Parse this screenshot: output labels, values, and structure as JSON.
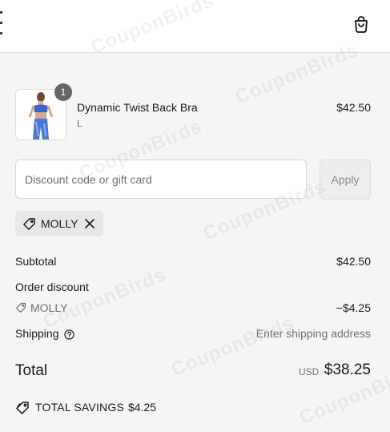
{
  "watermark": "CouponBirds",
  "header": {
    "menu_icon": "menu-icon",
    "cart_icon": "shopping-bag-icon"
  },
  "line_item": {
    "quantity": "1",
    "name": "Dynamic Twist Back Bra",
    "variant": "L",
    "price": "$42.50"
  },
  "discount": {
    "placeholder": "Discount code or gift card",
    "apply_label": "Apply",
    "applied_code": "MOLLY"
  },
  "summary": {
    "subtotal_label": "Subtotal",
    "subtotal_value": "$42.50",
    "order_discount_label": "Order discount",
    "discount_code": "MOLLY",
    "discount_value": "−$4.25",
    "shipping_label": "Shipping",
    "shipping_value": "Enter shipping address",
    "total_label": "Total",
    "currency": "USD",
    "total_value": "$38.25",
    "savings_label": "TOTAL SAVINGS",
    "savings_value": "$4.25"
  },
  "colors": {
    "background": "#f5f5f5",
    "text": "#1a1a1a",
    "muted": "#707070",
    "badge": "#666666"
  }
}
